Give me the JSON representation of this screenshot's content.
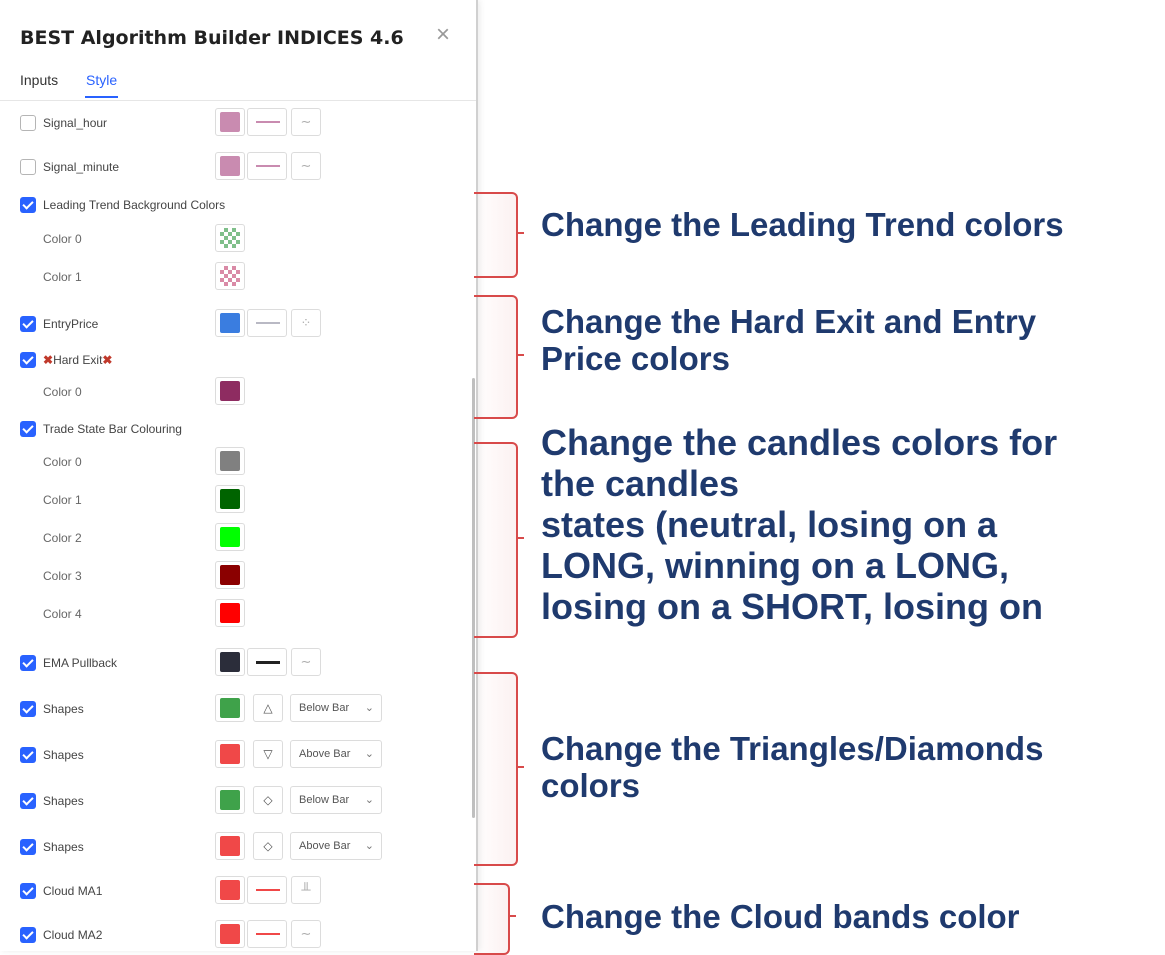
{
  "dialog": {
    "title": "BEST Algorithm Builder INDICES 4.6",
    "close_icon": "×",
    "tabs": [
      {
        "label": "Inputs",
        "active": false
      },
      {
        "label": "Style",
        "active": true
      }
    ]
  },
  "rows": {
    "signal_hour": {
      "label": "Signal_hour",
      "checked": false,
      "color": "#c98bb0"
    },
    "signal_minute": {
      "label": "Signal_minute",
      "checked": false,
      "color": "#c98bb0"
    },
    "leading_trend": {
      "label": "Leading Trend Background Colors",
      "checked": true
    },
    "leading_color0": {
      "label": "Color 0",
      "color": "#7fbf8a"
    },
    "leading_color1": {
      "label": "Color 1",
      "color": "#d98aa6"
    },
    "entry_price": {
      "label": "EntryPrice",
      "checked": true,
      "color": "#3a7de0"
    },
    "hard_exit": {
      "label": "Hard Exit",
      "checked": true,
      "marker": "✖"
    },
    "hard_exit_color0": {
      "label": "Color 0",
      "color": "#8e2c61"
    },
    "trade_state": {
      "label": "Trade State Bar Colouring",
      "checked": true
    },
    "trade_colors": [
      {
        "label": "Color 0",
        "color": "#808080"
      },
      {
        "label": "Color 1",
        "color": "#006400"
      },
      {
        "label": "Color 2",
        "color": "#00ff00"
      },
      {
        "label": "Color 3",
        "color": "#8b0000"
      },
      {
        "label": "Color 4",
        "color": "#ff0000"
      }
    ],
    "ema_pullback": {
      "label": "EMA Pullback",
      "checked": true,
      "color": "#2b2d3a"
    },
    "shapes": [
      {
        "label": "Shapes",
        "checked": true,
        "color": "#3fa24a",
        "shape_glyph": "△",
        "position": "Below Bar"
      },
      {
        "label": "Shapes",
        "checked": true,
        "color": "#f04848",
        "shape_glyph": "▽",
        "position": "Above Bar"
      },
      {
        "label": "Shapes",
        "checked": true,
        "color": "#3fa24a",
        "shape_glyph": "◇",
        "position": "Below Bar"
      },
      {
        "label": "Shapes",
        "checked": true,
        "color": "#f04848",
        "shape_glyph": "◇",
        "position": "Above Bar"
      }
    ],
    "cloud_ma1": {
      "label": "Cloud MA1",
      "checked": true,
      "color": "#f04848"
    },
    "cloud_ma2": {
      "label": "Cloud MA2",
      "checked": true,
      "color": "#f04848"
    }
  },
  "annotations": [
    {
      "text": "Change the Leading Trend colors"
    },
    {
      "text": "Change the Hard Exit and Entry\nPrice colors"
    },
    {
      "text": "Change the candles colors for\nthe candles\nstates (neutral, losing on a\nLONG, winning on a LONG,\nlosing on a SHORT, losing on"
    },
    {
      "text": "Change the Triangles/Diamonds\ncolors"
    },
    {
      "text": "Change the Cloud bands color"
    }
  ],
  "colors": {
    "accent": "#2962ff",
    "bracket": "#d84a4a",
    "annotation_text": "#1f3a6e"
  }
}
